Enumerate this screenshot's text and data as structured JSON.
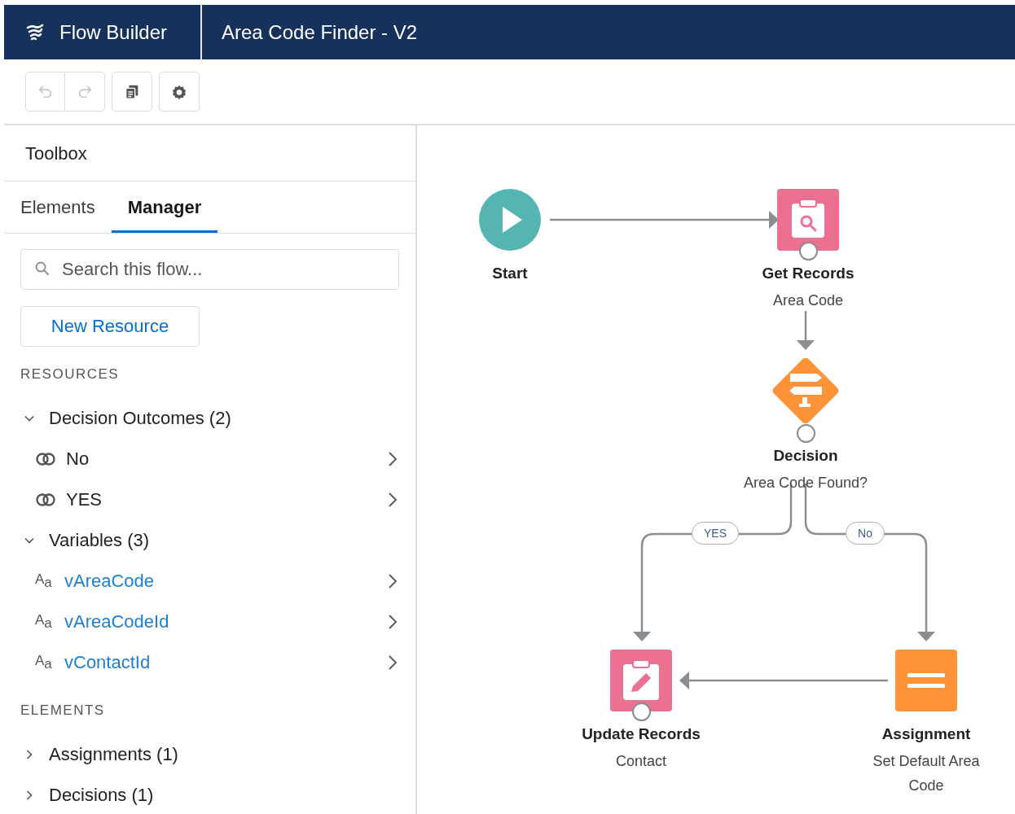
{
  "header": {
    "app_title": "Flow Builder",
    "flow_title": "Area Code Finder - V2"
  },
  "toolbar": {
    "buttons": [
      {
        "kind": "undo",
        "disabled": true
      },
      {
        "kind": "redo",
        "disabled": true
      },
      {
        "kind": "copy",
        "disabled": false
      },
      {
        "kind": "settings",
        "disabled": false
      }
    ]
  },
  "toolbox": {
    "title": "Toolbox",
    "tabs": [
      {
        "label": "Elements",
        "selected": false
      },
      {
        "label": "Manager",
        "selected": true
      }
    ],
    "search": {
      "placeholder": "Search this flow..."
    },
    "new_resource_button": "New Resource",
    "sections": [
      {
        "heading": "RESOURCES",
        "groups": [
          {
            "label": "Decision Outcomes (2)",
            "expanded": true,
            "children": [
              {
                "kind": "outcome",
                "label": "No"
              },
              {
                "kind": "outcome",
                "label": "YES"
              }
            ]
          },
          {
            "label": "Variables (3)",
            "expanded": true,
            "children": [
              {
                "kind": "variable",
                "type_label": "A$_{a}$",
                "label": "vAreaCode"
              },
              {
                "kind": "variable",
                "type_label": "A$_{a}$",
                "label": "vAreaCodeId"
              },
              {
                "kind": "variable",
                "type_label": "A$_{a}$",
                "label": "vContactId"
              }
            ]
          }
        ]
      },
      {
        "heading": "ELEMENTS",
        "groups": [
          {
            "label": "Assignments (1)",
            "expanded": false
          },
          {
            "label": "Decisions (1)",
            "expanded": false
          }
        ]
      }
    ]
  },
  "canvas": {
    "nodes": [
      {
        "kind": "start",
        "title": "Start"
      },
      {
        "kind": "get_records",
        "title": "Get Records",
        "subtitle": "Area Code"
      },
      {
        "kind": "decision",
        "title": "Decision",
        "subtitle": "Area Code Found?"
      },
      {
        "kind": "update_records",
        "title": "Update Records",
        "subtitle": "Contact"
      },
      {
        "kind": "assignment",
        "title": "Assignment",
        "subtitle": "Set Default Area Code"
      }
    ],
    "branch_labels": [
      "YES",
      "No"
    ]
  }
}
